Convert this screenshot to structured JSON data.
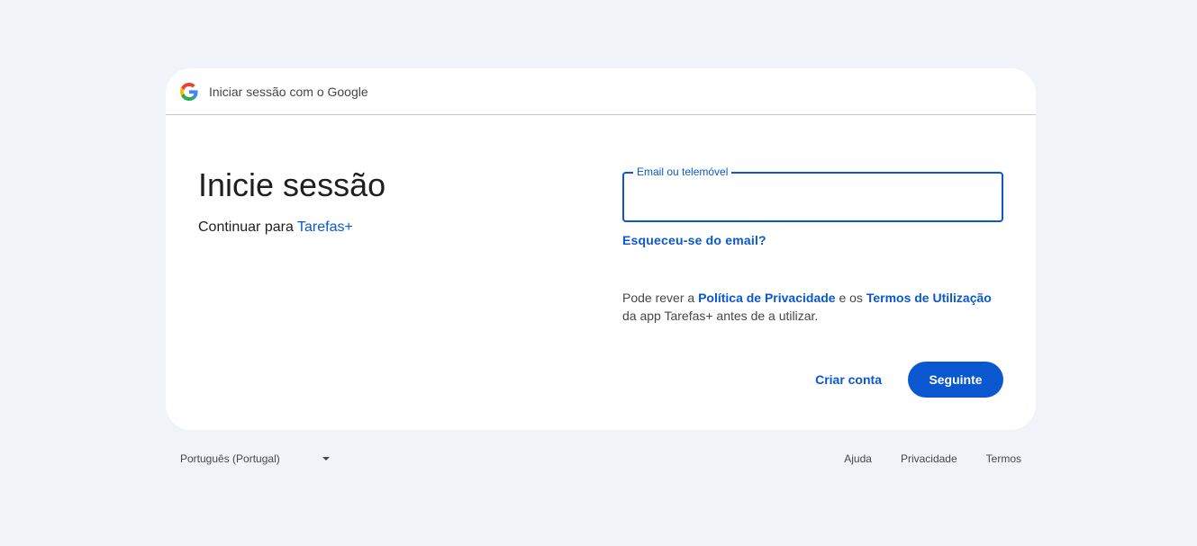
{
  "header": {
    "title": "Iniciar sessão com o Google",
    "logo_icon": "google-g-icon"
  },
  "main": {
    "headline": "Inicie sessão",
    "continue_prefix": "Continuar para",
    "app_name": "Tarefas+"
  },
  "form": {
    "email_label": "Email ou telemóvel",
    "email_value": "",
    "forgot_email": "Esqueceu-se do email?",
    "privacy_prefix": "Pode rever a",
    "privacy_link": "Política de Privacidade",
    "privacy_middle": "e os",
    "terms_link": "Termos de Utilização",
    "privacy_suffix": "da app Tarefas+ antes de a utilizar."
  },
  "actions": {
    "create_account": "Criar conta",
    "next": "Seguinte"
  },
  "footer": {
    "language": "Português (Portugal)",
    "links": [
      "Ajuda",
      "Privacidade",
      "Termos"
    ]
  },
  "colors": {
    "accent": "#0b57d0",
    "background": "#f0f4f9",
    "card": "#ffffff"
  }
}
